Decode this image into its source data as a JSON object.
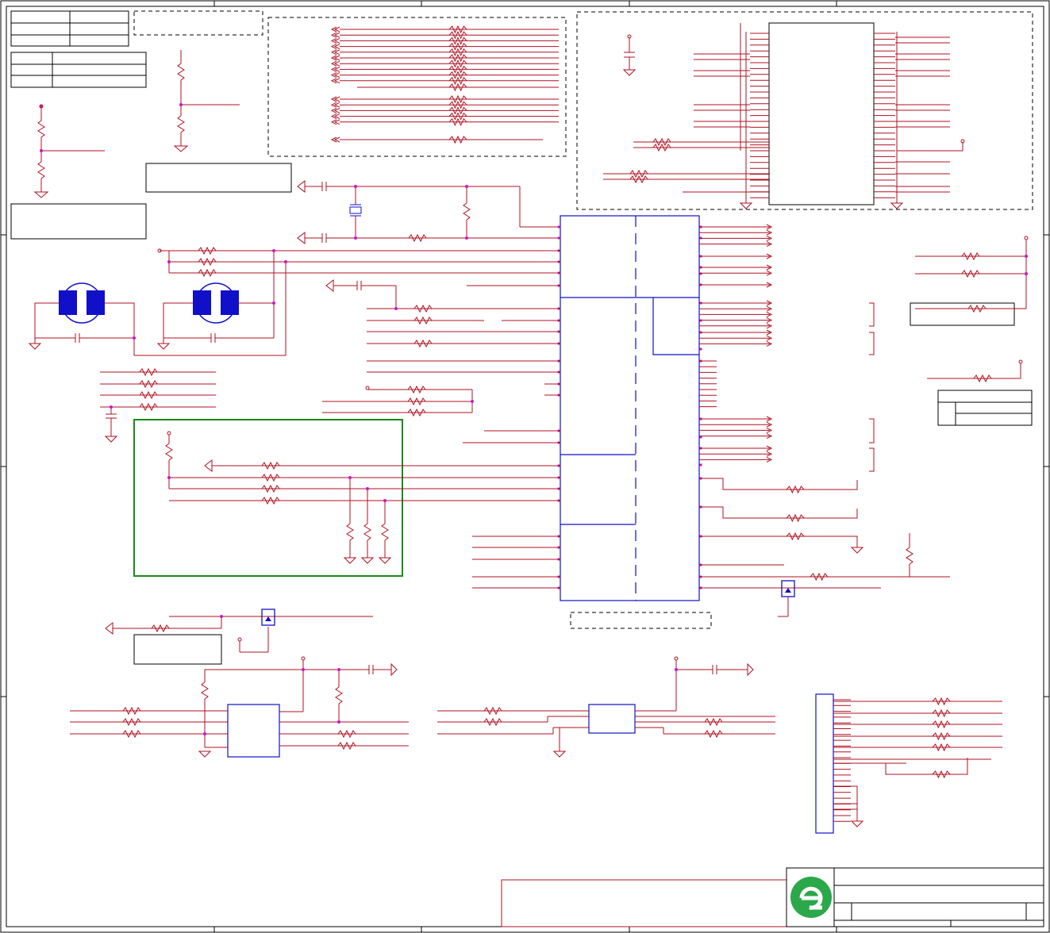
{
  "title_block": {
    "logo_icon": "company-logo-icon",
    "brand_color": "#2aa84a"
  },
  "colors": {
    "wire": "#b01020",
    "component": "#1010c8",
    "junction": "#c818c8",
    "highlight_box": "#1a8a1a",
    "frame": "#000000"
  }
}
